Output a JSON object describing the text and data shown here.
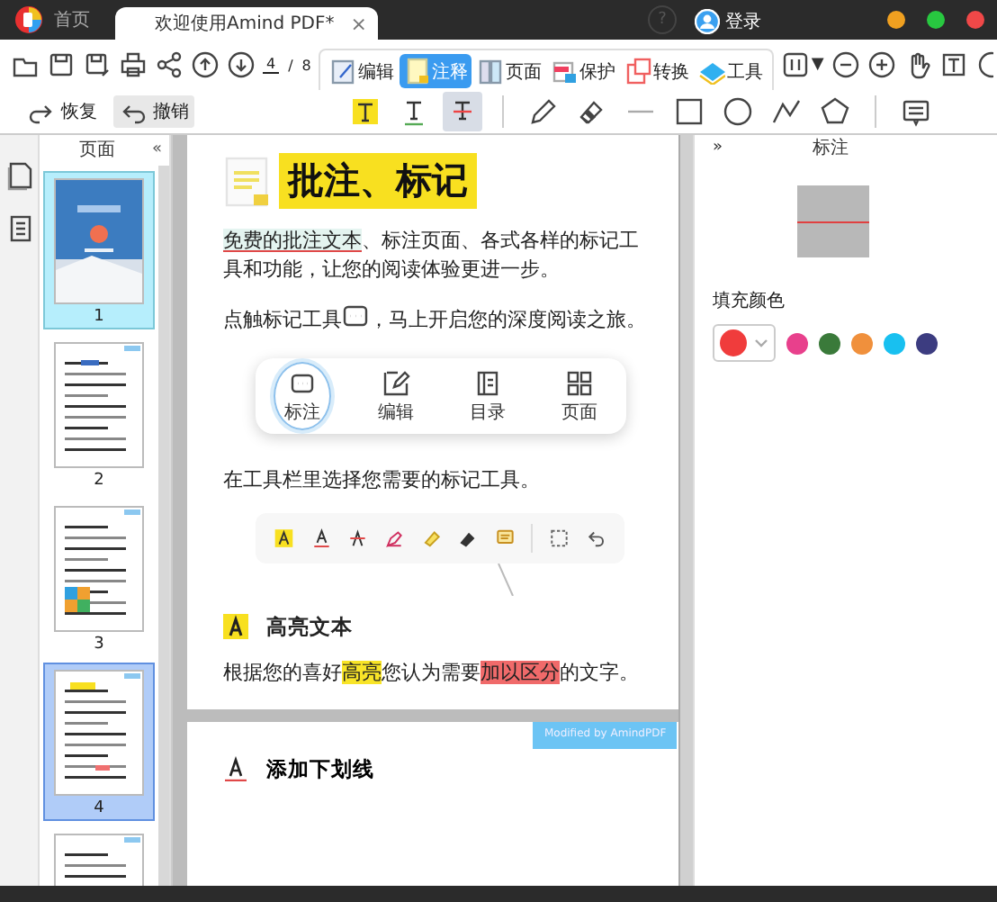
{
  "title_bar": {
    "tabs": [
      {
        "label": "首页",
        "selected": false
      },
      {
        "label": "欢迎使用Amind PDF*",
        "selected": true
      }
    ],
    "close": "×",
    "help": "?",
    "user": "登录"
  },
  "toolbar": {
    "page_current": "4",
    "page_separator": "/",
    "page_total": "8",
    "tabs": [
      {
        "kind": "edit",
        "label": "编辑",
        "selected": false
      },
      {
        "kind": "annotate",
        "label": "注释",
        "selected": true
      },
      {
        "kind": "page",
        "label": "页面",
        "selected": false
      },
      {
        "kind": "protect",
        "label": "保护",
        "selected": false
      },
      {
        "kind": "convert",
        "label": "转换",
        "selected": false
      },
      {
        "kind": "tools",
        "label": "工具",
        "selected": false
      }
    ],
    "view_caret": "▼"
  },
  "annotate_toolbar": {
    "redo": "恢复",
    "undo": "撤销",
    "tools": [
      {
        "kind": "highlight",
        "selected": false
      },
      {
        "kind": "underline",
        "selected": false
      },
      {
        "kind": "strikethrough",
        "selected": true
      },
      {
        "kind": "divider",
        "selected": false
      },
      {
        "kind": "pencil",
        "selected": false
      },
      {
        "kind": "eraser",
        "selected": false
      },
      {
        "kind": "line",
        "selected": false
      },
      {
        "kind": "rectangle",
        "selected": false
      },
      {
        "kind": "circle",
        "selected": false
      },
      {
        "kind": "polyline",
        "selected": false
      },
      {
        "kind": "polygon",
        "selected": false
      },
      {
        "kind": "divider",
        "selected": false
      },
      {
        "kind": "comment",
        "selected": false
      }
    ]
  },
  "thumbnails": {
    "title": "页面",
    "collapse": "«",
    "pages": [
      {
        "number": "1",
        "selected": false,
        "hovered": true
      },
      {
        "number": "2",
        "selected": false,
        "hovered": false
      },
      {
        "number": "3",
        "selected": false,
        "hovered": false
      },
      {
        "number": "4",
        "selected": true,
        "hovered": false
      },
      {
        "selected": false,
        "hovered": false
      }
    ]
  },
  "document": {
    "heading": "批注、标记",
    "paragraphs": [
      {
        "segments": [
          {
            "text": "免费的批注文本",
            "underlined": true
          },
          {
            "text": "、标注页面、各式各样的标记工具和功能，让您的阅读体验更进一步。",
            "underlined": false
          }
        ]
      },
      {
        "segments": [
          {
            "text": "点触标记工具",
            "underlined": false
          },
          {
            "kind": "icon"
          },
          {
            "text": "，马上开启您的深度阅读之旅。",
            "underlined": false
          }
        ]
      }
    ],
    "tool_card": [
      {
        "kind": "comment",
        "label": "标注",
        "selected": true
      },
      {
        "kind": "edit",
        "label": "编辑",
        "selected": false
      },
      {
        "kind": "outline",
        "label": "目录",
        "selected": false
      },
      {
        "kind": "pages",
        "label": "页面",
        "selected": false
      }
    ],
    "toolbar_intro": "在工具栏里选择您需要的标记工具。",
    "section_heading": "高亮文本",
    "section_paragraph": {
      "segments": [
        {
          "text": "根据您的喜好"
        },
        {
          "text": "高亮",
          "color": "#f8e428"
        },
        {
          "text": "您认为需要"
        },
        {
          "text": "加以区分",
          "color": "#f06a6a"
        },
        {
          "text": "的文字。"
        }
      ]
    },
    "stamp": "Modified by AmindPDF",
    "next_heading": "添加下划线"
  },
  "properties": {
    "expand": "»",
    "title": "标注",
    "fill": {
      "label": "填充颜色",
      "color": "#f03c3c"
    },
    "swatches": [
      {
        "color": "#e8408c"
      },
      {
        "color": "#3a7a3a"
      },
      {
        "color": "#f0903c"
      },
      {
        "color": "#18c0f0"
      },
      {
        "color": "#3c3c80"
      }
    ]
  }
}
